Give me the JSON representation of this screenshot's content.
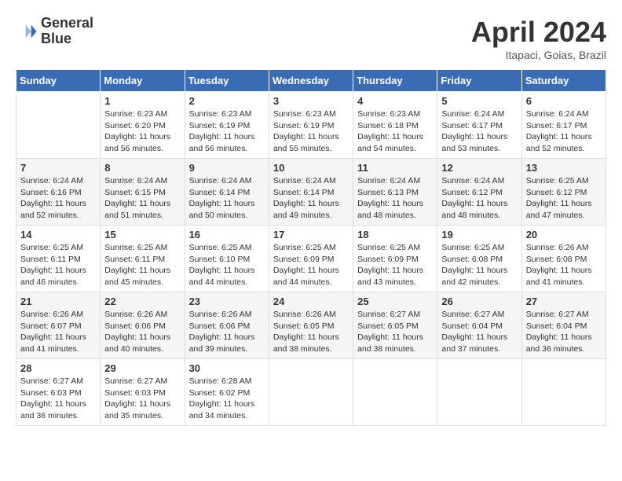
{
  "header": {
    "logo_line1": "General",
    "logo_line2": "Blue",
    "month": "April 2024",
    "location": "Itapaci, Goias, Brazil"
  },
  "weekdays": [
    "Sunday",
    "Monday",
    "Tuesday",
    "Wednesday",
    "Thursday",
    "Friday",
    "Saturday"
  ],
  "weeks": [
    [
      {
        "day": "",
        "sunrise": "",
        "sunset": "",
        "daylight": ""
      },
      {
        "day": "1",
        "sunrise": "Sunrise: 6:23 AM",
        "sunset": "Sunset: 6:20 PM",
        "daylight": "Daylight: 11 hours and 56 minutes."
      },
      {
        "day": "2",
        "sunrise": "Sunrise: 6:23 AM",
        "sunset": "Sunset: 6:19 PM",
        "daylight": "Daylight: 11 hours and 56 minutes."
      },
      {
        "day": "3",
        "sunrise": "Sunrise: 6:23 AM",
        "sunset": "Sunset: 6:19 PM",
        "daylight": "Daylight: 11 hours and 55 minutes."
      },
      {
        "day": "4",
        "sunrise": "Sunrise: 6:23 AM",
        "sunset": "Sunset: 6:18 PM",
        "daylight": "Daylight: 11 hours and 54 minutes."
      },
      {
        "day": "5",
        "sunrise": "Sunrise: 6:24 AM",
        "sunset": "Sunset: 6:17 PM",
        "daylight": "Daylight: 11 hours and 53 minutes."
      },
      {
        "day": "6",
        "sunrise": "Sunrise: 6:24 AM",
        "sunset": "Sunset: 6:17 PM",
        "daylight": "Daylight: 11 hours and 52 minutes."
      }
    ],
    [
      {
        "day": "7",
        "sunrise": "Sunrise: 6:24 AM",
        "sunset": "Sunset: 6:16 PM",
        "daylight": "Daylight: 11 hours and 52 minutes."
      },
      {
        "day": "8",
        "sunrise": "Sunrise: 6:24 AM",
        "sunset": "Sunset: 6:15 PM",
        "daylight": "Daylight: 11 hours and 51 minutes."
      },
      {
        "day": "9",
        "sunrise": "Sunrise: 6:24 AM",
        "sunset": "Sunset: 6:14 PM",
        "daylight": "Daylight: 11 hours and 50 minutes."
      },
      {
        "day": "10",
        "sunrise": "Sunrise: 6:24 AM",
        "sunset": "Sunset: 6:14 PM",
        "daylight": "Daylight: 11 hours and 49 minutes."
      },
      {
        "day": "11",
        "sunrise": "Sunrise: 6:24 AM",
        "sunset": "Sunset: 6:13 PM",
        "daylight": "Daylight: 11 hours and 48 minutes."
      },
      {
        "day": "12",
        "sunrise": "Sunrise: 6:24 AM",
        "sunset": "Sunset: 6:12 PM",
        "daylight": "Daylight: 11 hours and 48 minutes."
      },
      {
        "day": "13",
        "sunrise": "Sunrise: 6:25 AM",
        "sunset": "Sunset: 6:12 PM",
        "daylight": "Daylight: 11 hours and 47 minutes."
      }
    ],
    [
      {
        "day": "14",
        "sunrise": "Sunrise: 6:25 AM",
        "sunset": "Sunset: 6:11 PM",
        "daylight": "Daylight: 11 hours and 46 minutes."
      },
      {
        "day": "15",
        "sunrise": "Sunrise: 6:25 AM",
        "sunset": "Sunset: 6:11 PM",
        "daylight": "Daylight: 11 hours and 45 minutes."
      },
      {
        "day": "16",
        "sunrise": "Sunrise: 6:25 AM",
        "sunset": "Sunset: 6:10 PM",
        "daylight": "Daylight: 11 hours and 44 minutes."
      },
      {
        "day": "17",
        "sunrise": "Sunrise: 6:25 AM",
        "sunset": "Sunset: 6:09 PM",
        "daylight": "Daylight: 11 hours and 44 minutes."
      },
      {
        "day": "18",
        "sunrise": "Sunrise: 6:25 AM",
        "sunset": "Sunset: 6:09 PM",
        "daylight": "Daylight: 11 hours and 43 minutes."
      },
      {
        "day": "19",
        "sunrise": "Sunrise: 6:25 AM",
        "sunset": "Sunset: 6:08 PM",
        "daylight": "Daylight: 11 hours and 42 minutes."
      },
      {
        "day": "20",
        "sunrise": "Sunrise: 6:26 AM",
        "sunset": "Sunset: 6:08 PM",
        "daylight": "Daylight: 11 hours and 41 minutes."
      }
    ],
    [
      {
        "day": "21",
        "sunrise": "Sunrise: 6:26 AM",
        "sunset": "Sunset: 6:07 PM",
        "daylight": "Daylight: 11 hours and 41 minutes."
      },
      {
        "day": "22",
        "sunrise": "Sunrise: 6:26 AM",
        "sunset": "Sunset: 6:06 PM",
        "daylight": "Daylight: 11 hours and 40 minutes."
      },
      {
        "day": "23",
        "sunrise": "Sunrise: 6:26 AM",
        "sunset": "Sunset: 6:06 PM",
        "daylight": "Daylight: 11 hours and 39 minutes."
      },
      {
        "day": "24",
        "sunrise": "Sunrise: 6:26 AM",
        "sunset": "Sunset: 6:05 PM",
        "daylight": "Daylight: 11 hours and 38 minutes."
      },
      {
        "day": "25",
        "sunrise": "Sunrise: 6:27 AM",
        "sunset": "Sunset: 6:05 PM",
        "daylight": "Daylight: 11 hours and 38 minutes."
      },
      {
        "day": "26",
        "sunrise": "Sunrise: 6:27 AM",
        "sunset": "Sunset: 6:04 PM",
        "daylight": "Daylight: 11 hours and 37 minutes."
      },
      {
        "day": "27",
        "sunrise": "Sunrise: 6:27 AM",
        "sunset": "Sunset: 6:04 PM",
        "daylight": "Daylight: 11 hours and 36 minutes."
      }
    ],
    [
      {
        "day": "28",
        "sunrise": "Sunrise: 6:27 AM",
        "sunset": "Sunset: 6:03 PM",
        "daylight": "Daylight: 11 hours and 36 minutes."
      },
      {
        "day": "29",
        "sunrise": "Sunrise: 6:27 AM",
        "sunset": "Sunset: 6:03 PM",
        "daylight": "Daylight: 11 hours and 35 minutes."
      },
      {
        "day": "30",
        "sunrise": "Sunrise: 6:28 AM",
        "sunset": "Sunset: 6:02 PM",
        "daylight": "Daylight: 11 hours and 34 minutes."
      },
      {
        "day": "",
        "sunrise": "",
        "sunset": "",
        "daylight": ""
      },
      {
        "day": "",
        "sunrise": "",
        "sunset": "",
        "daylight": ""
      },
      {
        "day": "",
        "sunrise": "",
        "sunset": "",
        "daylight": ""
      },
      {
        "day": "",
        "sunrise": "",
        "sunset": "",
        "daylight": ""
      }
    ]
  ]
}
